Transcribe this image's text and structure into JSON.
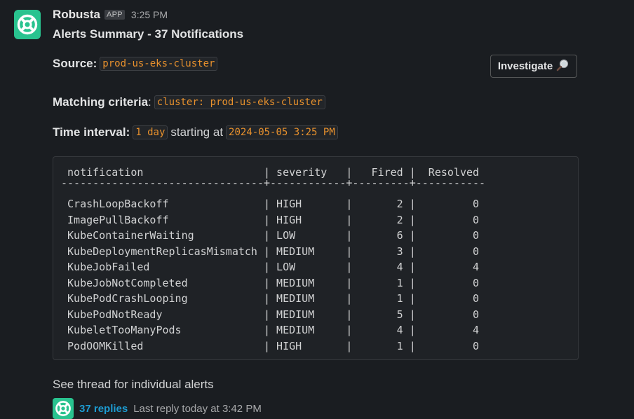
{
  "message": {
    "sender": "Robusta",
    "app_badge": "APP",
    "time": "3:25 PM",
    "title": "Alerts Summary - 37 Notifications",
    "source_label": "Source:",
    "source_value": "prod-us-eks-cluster",
    "criteria_label": "Matching criteria",
    "criteria_colon": ":",
    "criteria_value": "cluster: prod-us-eks-cluster",
    "interval_label": "Time interval:",
    "interval_value": "1 day",
    "interval_mid": "starting at",
    "interval_start": "2024-05-05 3:25 PM",
    "investigate_label": "Investigate",
    "thread_note": "See thread for individual alerts"
  },
  "table": {
    "columns": [
      "notification",
      "severity",
      "Fired",
      "Resolved"
    ],
    "rows": [
      [
        "CrashLoopBackoff",
        "HIGH",
        "2",
        "0"
      ],
      [
        "ImagePullBackoff",
        "HIGH",
        "2",
        "0"
      ],
      [
        "KubeContainerWaiting",
        "LOW",
        "6",
        "0"
      ],
      [
        "KubeDeploymentReplicasMismatch",
        "MEDIUM",
        "3",
        "0"
      ],
      [
        "KubeJobFailed",
        "LOW",
        "4",
        "4"
      ],
      [
        "KubeJobNotCompleted",
        "MEDIUM",
        "1",
        "0"
      ],
      [
        "KubePodCrashLooping",
        "MEDIUM",
        "1",
        "0"
      ],
      [
        "KubePodNotReady",
        "MEDIUM",
        "5",
        "0"
      ],
      [
        "KubeletTooManyPods",
        "MEDIUM",
        "4",
        "4"
      ],
      [
        "PodOOMKilled",
        "HIGH",
        "1",
        "0"
      ]
    ]
  },
  "thread": {
    "replies": "37 replies",
    "last_reply": "Last reply today at 3:42 PM"
  },
  "colors": {
    "background": "#1a1d21",
    "brand": "#29c38f",
    "code_text": "#e8912d",
    "link": "#1d9bd1"
  },
  "icons": {
    "avatar": "robusta-logo-icon",
    "investigate": "magnifying-glass-icon"
  }
}
